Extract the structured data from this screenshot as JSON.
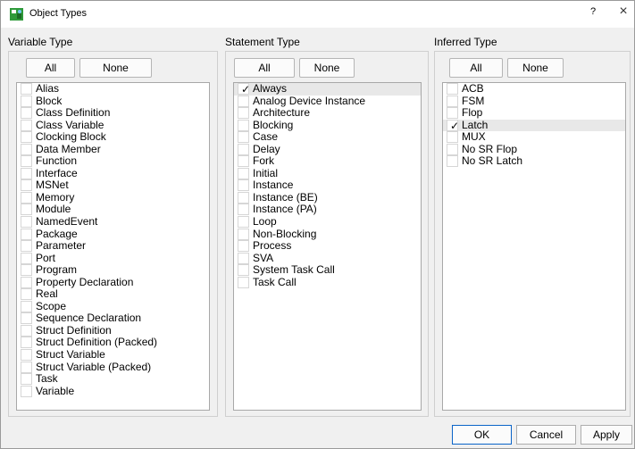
{
  "window": {
    "title": "Object Types",
    "help_label": "?",
    "close_label": "×"
  },
  "panels": {
    "variable": {
      "label": "Variable Type",
      "all_label": "All",
      "none_label": "None",
      "items": [
        {
          "label": "Alias",
          "checked": false
        },
        {
          "label": "Block",
          "checked": false
        },
        {
          "label": "Class Definition",
          "checked": false
        },
        {
          "label": "Class Variable",
          "checked": false
        },
        {
          "label": "Clocking Block",
          "checked": false
        },
        {
          "label": "Data Member",
          "checked": false
        },
        {
          "label": "Function",
          "checked": false
        },
        {
          "label": "Interface",
          "checked": false
        },
        {
          "label": "MSNet",
          "checked": false
        },
        {
          "label": "Memory",
          "checked": false
        },
        {
          "label": "Module",
          "checked": false
        },
        {
          "label": "NamedEvent",
          "checked": false
        },
        {
          "label": "Package",
          "checked": false
        },
        {
          "label": "Parameter",
          "checked": false
        },
        {
          "label": "Port",
          "checked": false
        },
        {
          "label": "Program",
          "checked": false
        },
        {
          "label": "Property Declaration",
          "checked": false
        },
        {
          "label": "Real",
          "checked": false
        },
        {
          "label": "Scope",
          "checked": false
        },
        {
          "label": "Sequence Declaration",
          "checked": false
        },
        {
          "label": "Struct Definition",
          "checked": false
        },
        {
          "label": "Struct Definition (Packed)",
          "checked": false
        },
        {
          "label": "Struct Variable",
          "checked": false
        },
        {
          "label": "Struct Variable (Packed)",
          "checked": false
        },
        {
          "label": "Task",
          "checked": false
        },
        {
          "label": "Variable",
          "checked": false
        }
      ]
    },
    "statement": {
      "label": "Statement Type",
      "all_label": "All",
      "none_label": "None",
      "items": [
        {
          "label": "Always",
          "checked": true
        },
        {
          "label": "Analog Device Instance",
          "checked": false
        },
        {
          "label": "Architecture",
          "checked": false
        },
        {
          "label": "Blocking",
          "checked": false
        },
        {
          "label": "Case",
          "checked": false
        },
        {
          "label": "Delay",
          "checked": false
        },
        {
          "label": "Fork",
          "checked": false
        },
        {
          "label": "Initial",
          "checked": false
        },
        {
          "label": "Instance",
          "checked": false
        },
        {
          "label": "Instance (BE)",
          "checked": false
        },
        {
          "label": "Instance (PA)",
          "checked": false
        },
        {
          "label": "Loop",
          "checked": false
        },
        {
          "label": "Non-Blocking",
          "checked": false
        },
        {
          "label": "Process",
          "checked": false
        },
        {
          "label": "SVA",
          "checked": false
        },
        {
          "label": "System Task Call",
          "checked": false
        },
        {
          "label": "Task Call",
          "checked": false
        }
      ]
    },
    "inferred": {
      "label": "Inferred Type",
      "all_label": "All",
      "none_label": "None",
      "items": [
        {
          "label": "ACB",
          "checked": false
        },
        {
          "label": "FSM",
          "checked": false
        },
        {
          "label": "Flop",
          "checked": false
        },
        {
          "label": "Latch",
          "checked": true
        },
        {
          "label": "MUX",
          "checked": false
        },
        {
          "label": "No SR Flop",
          "checked": false
        },
        {
          "label": "No SR Latch",
          "checked": false
        }
      ]
    }
  },
  "footer": {
    "ok_label": "OK",
    "cancel_label": "Cancel",
    "apply_label": "Apply"
  },
  "icons": {
    "app": "app-icon",
    "check": "checkmark-icon"
  },
  "colors": {
    "accent_border": "#0a64c8",
    "app_icon_green": "#2e9a3a"
  }
}
